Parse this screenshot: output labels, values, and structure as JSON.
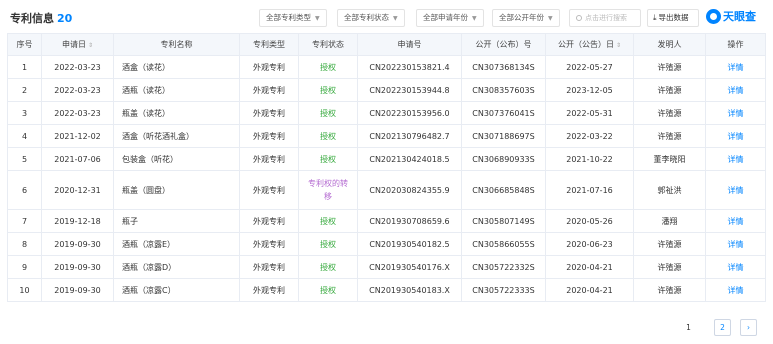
{
  "header": {
    "title": "专利信息",
    "count": "20",
    "filters": [
      "全部专利类型",
      "全部专利状态",
      "全部申请年份",
      "全部公开年份"
    ],
    "search_placeholder": "点击进行搜索",
    "export_label": "导出数据",
    "logo_text": "天眼查"
  },
  "table": {
    "columns": [
      "序号",
      "申请日",
      "专利名称",
      "专利类型",
      "专利状态",
      "申请号",
      "公开（公布）号",
      "公开（公告）日",
      "发明人",
      "操作"
    ],
    "rows": [
      {
        "no": "1",
        "apply_date": "2022-03-23",
        "name": "酒盒（读花）",
        "type": "外观专利",
        "status": "授权",
        "apply_no": "CN202230153821.4",
        "pub_no": "CN307368134S",
        "pub_date": "2022-05-27",
        "inventor": "许殖源",
        "action": "详情"
      },
      {
        "no": "2",
        "apply_date": "2022-03-23",
        "name": "酒瓶（读花）",
        "type": "外观专利",
        "status": "授权",
        "apply_no": "CN202230153944.8",
        "pub_no": "CN308357603S",
        "pub_date": "2023-12-05",
        "inventor": "许殖源",
        "action": "详情"
      },
      {
        "no": "3",
        "apply_date": "2022-03-23",
        "name": "瓶盖（读花）",
        "type": "外观专利",
        "status": "授权",
        "apply_no": "CN202230153956.0",
        "pub_no": "CN307376041S",
        "pub_date": "2022-05-31",
        "inventor": "许殖源",
        "action": "详情"
      },
      {
        "no": "4",
        "apply_date": "2021-12-02",
        "name": "酒盒（听花酒礼盒）",
        "type": "外观专利",
        "status": "授权",
        "apply_no": "CN202130796482.7",
        "pub_no": "CN307188697S",
        "pub_date": "2022-03-22",
        "inventor": "许殖源",
        "action": "详情"
      },
      {
        "no": "5",
        "apply_date": "2021-07-06",
        "name": "包装盒（听花）",
        "type": "外观专利",
        "status": "授权",
        "apply_no": "CN202130424018.5",
        "pub_no": "CN306890933S",
        "pub_date": "2021-10-22",
        "inventor": "董李晓阳",
        "action": "详情"
      },
      {
        "no": "6",
        "apply_date": "2020-12-31",
        "name": "瓶盖（圆盘）",
        "type": "外观专利",
        "status": "专利权的转移",
        "apply_no": "CN202030824355.9",
        "pub_no": "CN306685848S",
        "pub_date": "2021-07-16",
        "inventor": "郭祉洪",
        "action": "详情"
      },
      {
        "no": "7",
        "apply_date": "2019-12-18",
        "name": "瓶子",
        "type": "外观专利",
        "status": "授权",
        "apply_no": "CN201930708659.6",
        "pub_no": "CN305807149S",
        "pub_date": "2020-05-26",
        "inventor": "潘翔",
        "action": "详情"
      },
      {
        "no": "8",
        "apply_date": "2019-09-30",
        "name": "酒瓶（凉露E）",
        "type": "外观专利",
        "status": "授权",
        "apply_no": "CN201930540182.5",
        "pub_no": "CN305866055S",
        "pub_date": "2020-06-23",
        "inventor": "许殖源",
        "action": "详情"
      },
      {
        "no": "9",
        "apply_date": "2019-09-30",
        "name": "酒瓶（凉露D）",
        "type": "外观专利",
        "status": "授权",
        "apply_no": "CN201930540176.X",
        "pub_no": "CN305722332S",
        "pub_date": "2020-04-21",
        "inventor": "许殖源",
        "action": "详情"
      },
      {
        "no": "10",
        "apply_date": "2019-09-30",
        "name": "酒瓶（凉露C）",
        "type": "外观专利",
        "status": "授权",
        "apply_no": "CN201930540183.X",
        "pub_no": "CN305722333S",
        "pub_date": "2020-04-21",
        "inventor": "许殖源",
        "action": "详情"
      }
    ]
  },
  "pagination": {
    "pages": [
      "1",
      "2"
    ],
    "current": "2",
    "next": "›"
  },
  "colors": {
    "accent": "#0084ff",
    "granted": "#36a93d",
    "transfer": "#b46bd1"
  }
}
